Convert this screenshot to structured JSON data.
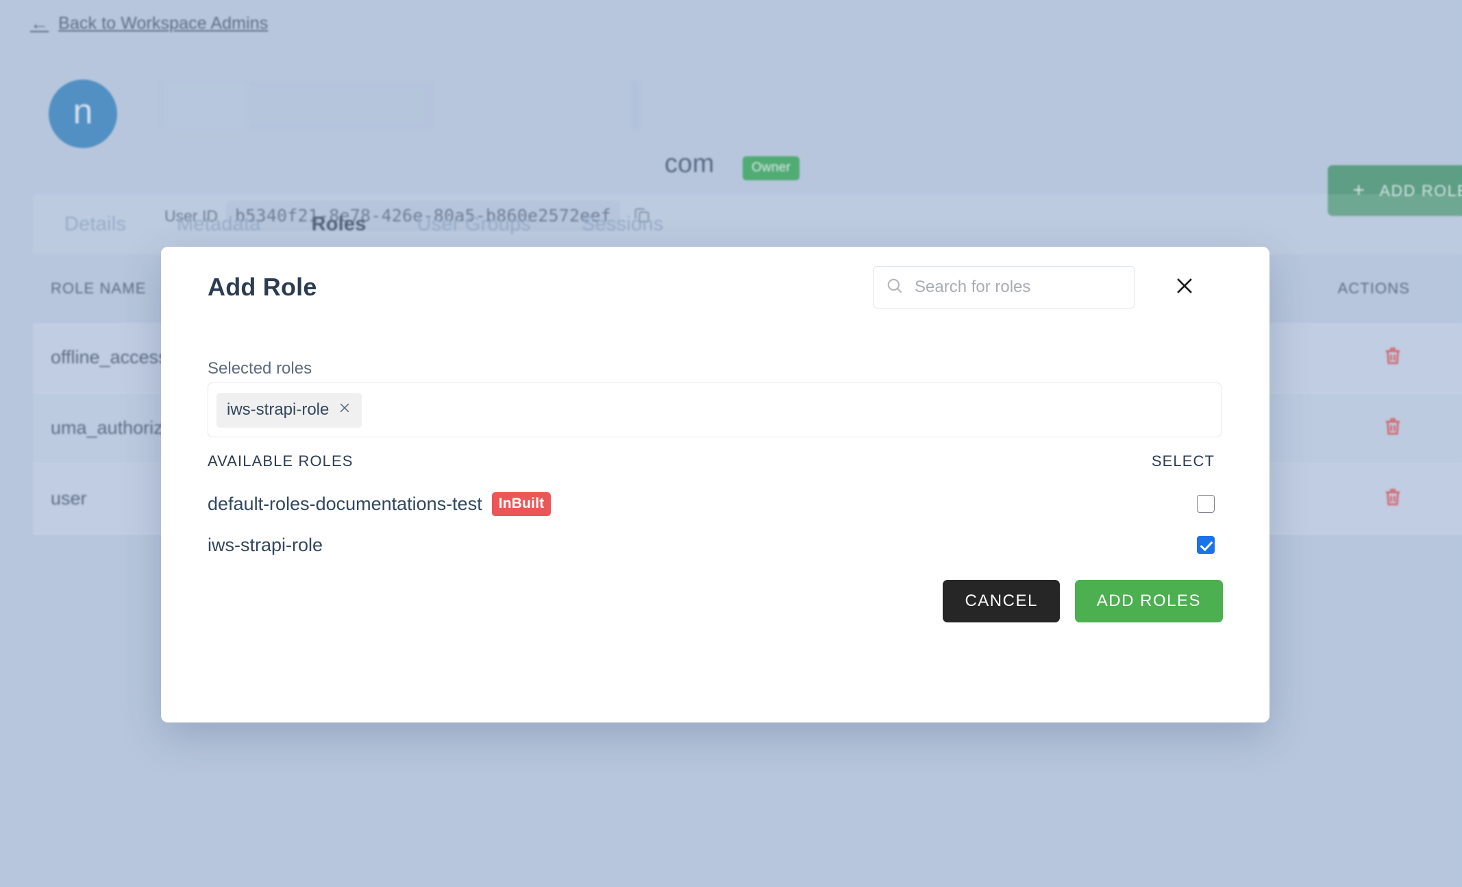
{
  "back_link": {
    "label": "Back to Workspace Admins",
    "icon": "arrow-left-icon"
  },
  "user": {
    "avatar_initial": "n",
    "name_redacted": "",
    "org_name": "com",
    "role_badge": "Owner",
    "user_id_label": "User ID",
    "user_id_value": "b5340f21-8e78-426e-80a5-b860e2572eef",
    "copy_icon": "copy-icon"
  },
  "header_actions": {
    "add_role_label": "ADD ROLE",
    "add_role_icon": "plus-icon"
  },
  "tabs": [
    {
      "label": "Details",
      "active": false
    },
    {
      "label": "Metadata",
      "active": false
    },
    {
      "label": "Roles",
      "active": true
    },
    {
      "label": "User Groups",
      "active": false
    },
    {
      "label": "Sessions",
      "active": false
    }
  ],
  "roles_table": {
    "columns": [
      "ROLE NAME",
      "ACTIONS"
    ],
    "rows": [
      {
        "role_name": "offline_access",
        "action_icon": "trash-icon"
      },
      {
        "role_name": "uma_authorization",
        "action_icon": "trash-icon"
      },
      {
        "role_name": "user",
        "action_icon": "trash-icon"
      }
    ]
  },
  "modal": {
    "title": "Add Role",
    "search": {
      "placeholder": "Search for roles",
      "value": "",
      "icon": "search-icon"
    },
    "close_icon": "close-icon",
    "selected_roles_label": "Selected roles",
    "selected_roles": [
      {
        "label": "iws-strapi-role",
        "remove_icon": "close-icon"
      }
    ],
    "available_header": "AVAILABLE ROLES",
    "select_header": "SELECT",
    "available_roles": [
      {
        "name": "default-roles-documentations-test",
        "badge": "InBuilt",
        "checked": false
      },
      {
        "name": "iws-strapi-role",
        "badge": "",
        "checked": true
      }
    ],
    "cancel_label": "CANCEL",
    "submit_label": "ADD ROLES"
  },
  "colors": {
    "page_background": "#b7c6dd",
    "accent_green": "#3b8f62",
    "owner_badge": "#2aa24a",
    "inbuilt_badge": "#eb5757",
    "checkbox_checked": "#1a73e8",
    "avatar": "#2b7cb9",
    "trash_icon": "#e03a3a",
    "cancel_button": "#262626",
    "submit_button": "#4caf50"
  }
}
